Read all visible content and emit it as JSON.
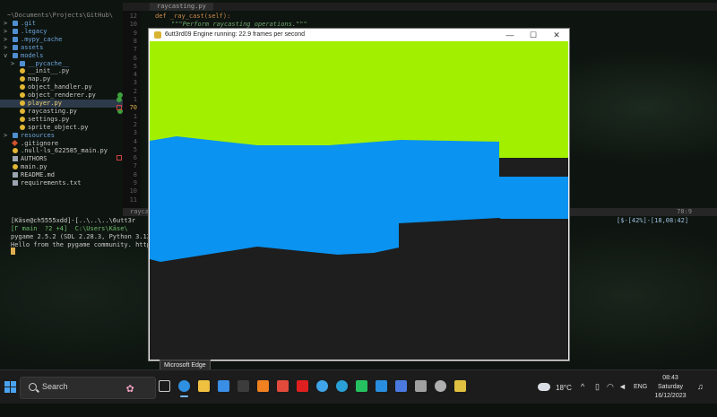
{
  "file_tree": {
    "path": "~\\Documents\\Projects\\GitHub\\",
    "items": [
      {
        "label": ".git",
        "kind": "folder",
        "arrow": ">"
      },
      {
        "label": ".legacy",
        "kind": "folder",
        "arrow": ">"
      },
      {
        "label": ".mypy_cache",
        "kind": "folder",
        "arrow": ">"
      },
      {
        "label": "assets",
        "kind": "folder",
        "arrow": ">"
      },
      {
        "label": "models",
        "kind": "folder",
        "arrow": "v"
      },
      {
        "label": "__pycache__",
        "kind": "folder",
        "arrow": ">"
      },
      {
        "label": "__init__.py",
        "kind": "py"
      },
      {
        "label": "map.py",
        "kind": "py"
      },
      {
        "label": "object_handler.py",
        "kind": "py"
      },
      {
        "label": "object_renderer.py",
        "kind": "py",
        "mark": "ok"
      },
      {
        "label": "player.py",
        "kind": "py",
        "selected": true
      },
      {
        "label": "raycasting.py",
        "kind": "py",
        "mark": "ok"
      },
      {
        "label": "settings.py",
        "kind": "py"
      },
      {
        "label": "sprite_object.py",
        "kind": "py"
      },
      {
        "label": "resources",
        "kind": "folder",
        "arrow": ">"
      },
      {
        "label": ".gitignore",
        "kind": "git"
      },
      {
        "label": ".null-ls_622585_main.py",
        "kind": "py"
      },
      {
        "label": "AUTHORS",
        "kind": "file"
      },
      {
        "label": "main.py",
        "kind": "py"
      },
      {
        "label": "README.md",
        "kind": "file"
      },
      {
        "label": "requirements.txt",
        "kind": "file"
      }
    ]
  },
  "editor": {
    "tab": "raycasting.py",
    "code_line1": "def _ray_cast(self):",
    "code_line2": "\"\"\"Perform raycasting operations.\"\"\"",
    "line_numbers": [
      "12",
      "10",
      "9",
      "8",
      "7",
      "6",
      "5",
      "4",
      "3",
      "2",
      "1",
      "70",
      "1",
      "2",
      "3",
      "4",
      "5",
      "6",
      "7",
      "8",
      "9",
      "10",
      "11"
    ],
    "current_line_index": 11,
    "status_file": "raycasting.py",
    "status_pos": "70:9"
  },
  "terminal": {
    "prompt": "[Käse@ch5555xdd]-[..\\..\\..\\6utt3r",
    "branch": "[Γ main  ?2 +4]  C:\\Users\\Käse\\",
    "line3": "pygame 2.5.2 (SDL 2.28.3, Python 3.12",
    "line4": "Hello from the pygame community. http",
    "right_status": "[$-[42%]-[18,08:42]"
  },
  "game_window": {
    "title": "6utt3rd09 Engine running: 22.9 frames per second",
    "minimize": "—",
    "maximize": "☐",
    "close": "✕",
    "colors": {
      "ceiling": "#a2f000",
      "wall": "#0a93f0",
      "floor": "#1e1e1e"
    }
  },
  "tooltip": "Microsoft Edge",
  "taskbar": {
    "search_placeholder": "Search",
    "icons": [
      "task-view-icon",
      "edge-icon",
      "file-explorer-icon",
      "mail-icon",
      "terminal-icon",
      "vlc-icon",
      "chrome-icon",
      "youtube-icon",
      "edge-beta-icon",
      "edge-dev-icon",
      "whatsapp-icon",
      "vscode-icon",
      "signal-icon",
      "cloud-icon",
      "settings-icon",
      "python-icon"
    ],
    "weather_temp": "18°C",
    "language": "ENG",
    "time": "08:43",
    "day": "Saturday",
    "date": "16/12/2023"
  }
}
